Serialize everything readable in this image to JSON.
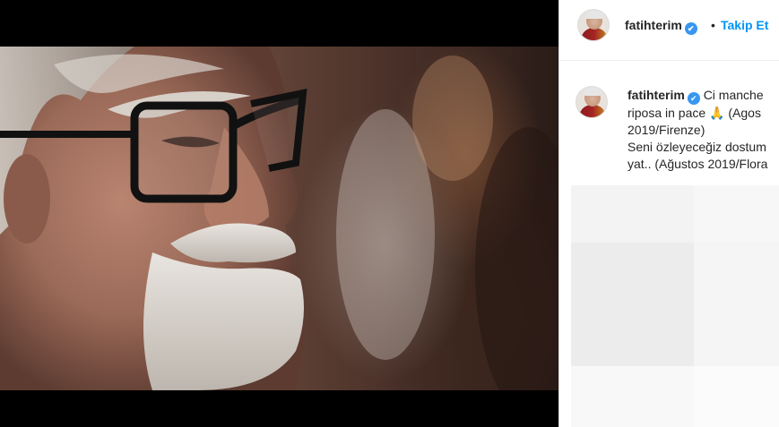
{
  "post": {
    "username": "fatihterim",
    "verified": true,
    "follow_label": "Takip Et",
    "separator": "•"
  },
  "caption": {
    "username": "fatihterim",
    "lines": [
      "Ci manche",
      "riposa in pace 🙏 (Agos",
      "2019/Firenze)",
      "Seni özleyeceğiz dostum",
      "yat.. (Ağustos 2019/Flora"
    ]
  },
  "icons": {
    "verified": "verified-badge-icon",
    "avatar": "profile-avatar"
  },
  "colors": {
    "link": "#0095f6",
    "verified": "#3897f0",
    "text": "#262626"
  }
}
